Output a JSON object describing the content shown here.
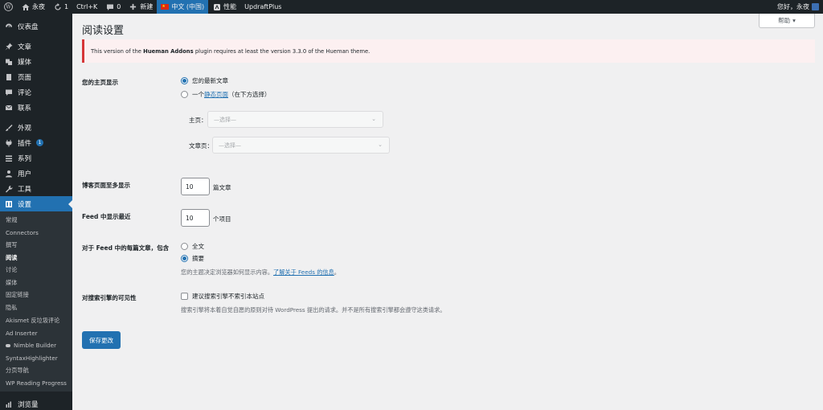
{
  "adminbar": {
    "wp_logo": "wordpress-icon",
    "site_name": "永夜",
    "updates_count": "1",
    "shortcut": "Ctrl+K",
    "comments_count": "0",
    "new_label": "新建",
    "language": "中文 (中国)",
    "performance": "性能",
    "updraft": "UpdraftPlus",
    "greeting": "您好，永夜"
  },
  "sidebar": {
    "items": [
      {
        "label": "仪表盘",
        "icon": "dashboard-icon"
      },
      {
        "label": "文章",
        "icon": "pin-icon"
      },
      {
        "label": "媒体",
        "icon": "media-icon"
      },
      {
        "label": "页面",
        "icon": "page-icon"
      },
      {
        "label": "评论",
        "icon": "comment-icon"
      },
      {
        "label": "联系",
        "icon": "mail-icon"
      },
      {
        "label": "外观",
        "icon": "brush-icon"
      },
      {
        "label": "插件",
        "icon": "plugin-icon",
        "badge": "1"
      },
      {
        "label": "系列",
        "icon": "series-icon"
      },
      {
        "label": "用户",
        "icon": "user-icon"
      },
      {
        "label": "工具",
        "icon": "wrench-icon"
      },
      {
        "label": "设置",
        "icon": "settings-icon"
      }
    ],
    "submenu": [
      "常规",
      "Connectors",
      "撰写",
      "阅读",
      "讨论",
      "媒体",
      "固定链接",
      "隐私",
      "Akismet 反垃圾评论",
      "Ad Inserter",
      "Nimble Builder",
      "SyntaxHighlighter",
      "分页导航",
      "WP Reading Progress"
    ],
    "next_item": "浏览量"
  },
  "main": {
    "help": "帮助",
    "title": "阅读设置",
    "notice": {
      "pre": "This version of the ",
      "plugin": "Hueman Addons",
      "post": " plugin requires at least the version 3.3.0 of the Hueman theme."
    },
    "homepage": {
      "label": "您的主页显示",
      "option_latest": "您的最新文章",
      "option_static_pre": "一个",
      "option_static_link": "静态页面",
      "option_static_post": "（在下方选择）",
      "front_label": "主页：",
      "posts_label": "文章页：",
      "select_placeholder": "—选择—"
    },
    "blog_pages": {
      "label": "博客页面至多显示",
      "value": "10",
      "unit": "篇文章"
    },
    "feed_count": {
      "label": "Feed 中显示最近",
      "value": "10",
      "unit": "个项目"
    },
    "feed_content": {
      "label": "对于 Feed 中的每篇文章，包含",
      "option_full": "全文",
      "option_excerpt": "摘要",
      "desc_pre": "您的主题决定浏览器如何显示内容。",
      "desc_link": "了解关于 Feeds 的信息",
      "desc_post": "。"
    },
    "visibility": {
      "label": "对搜索引擎的可见性",
      "checkbox_label": "建议搜索引擎不索引本站点",
      "desc": "搜索引擎将本着自觉自愿的原则对待 WordPress 提出的请求。并不是所有搜索引擎都会遵守这类请求。"
    },
    "save": "保存更改"
  },
  "colors": {
    "accent": "#2271b1",
    "admin_dark": "#1d2327",
    "notice_red": "#d63638"
  }
}
